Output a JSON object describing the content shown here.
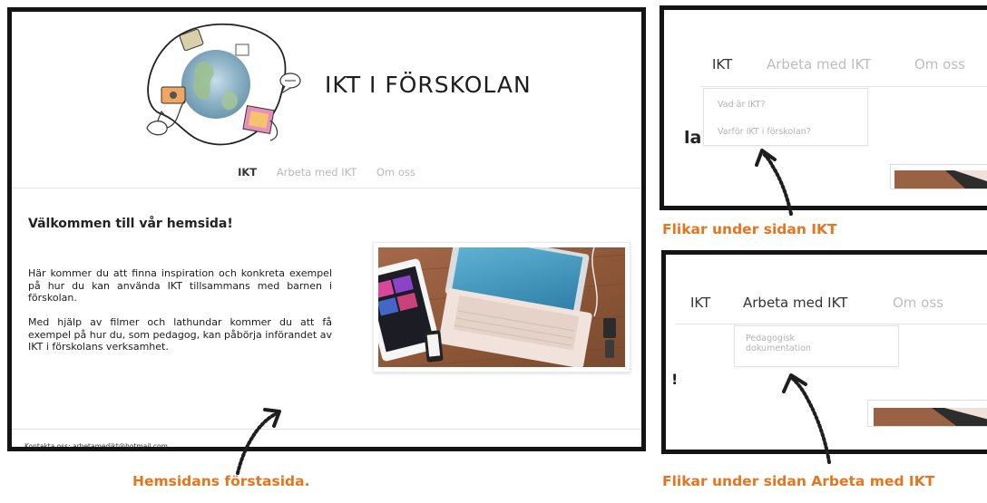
{
  "main_page": {
    "site_title": "IKT I FÖRSKOLAN",
    "nav": [
      {
        "label": "IKT",
        "active": true
      },
      {
        "label": "Arbeta med IKT",
        "active": false
      },
      {
        "label": "Om oss",
        "active": false
      }
    ],
    "welcome_heading": "Välkommen till vår hemsida!",
    "paragraphs": [
      "Här kommer du att finna inspiration och konkreta exempel på hur du kan använda IKT tillsammans med barnen i förskolan.",
      "Med hjälp av filmer och lathundar kommer du att få exempel på hur du, som pedagog, kan påbörja införandet av IKT i förskolans verksamhet."
    ],
    "footer": "Kontakta oss: arbetamedikt@hotmail.com"
  },
  "ikt_dropdown": {
    "tabs": [
      {
        "label": "IKT",
        "active": true
      },
      {
        "label": "Arbeta med IKT",
        "active": false
      },
      {
        "label": "Om oss",
        "active": false
      }
    ],
    "items": [
      "Vad är IKT?",
      "Varför IKT i förskolan?"
    ],
    "fragment": "la"
  },
  "arbeta_dropdown": {
    "tabs": [
      {
        "label": "IKT",
        "active": false
      },
      {
        "label": "Arbeta med IKT",
        "active": true
      },
      {
        "label": "Om oss",
        "active": false
      }
    ],
    "item_lines": [
      "Pedagogisk",
      "dokumentation"
    ],
    "fragment": "!"
  },
  "captions": {
    "main": "Hemsidans förstasida.",
    "ikt": "Flikar under sidan IKT",
    "arbeta": "Flikar under sidan Arbeta med IKT"
  },
  "colors": {
    "caption": "#e8741e",
    "frame_border": "#141414",
    "nav_inactive": "#b8b8b8",
    "nav_active": "#333333"
  }
}
